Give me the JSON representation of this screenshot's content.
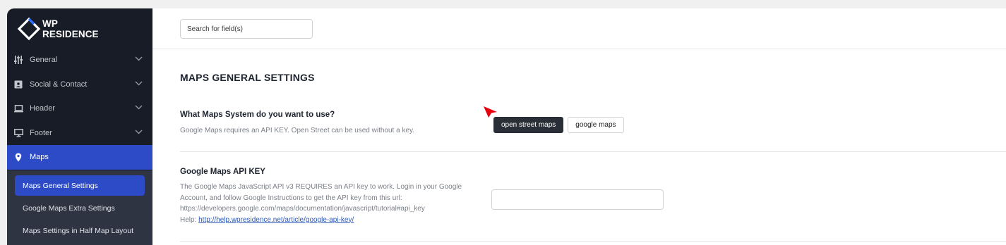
{
  "brand": {
    "line1": "WP",
    "line2": "RESIDENCE"
  },
  "sidebar": {
    "items": [
      {
        "label": "General",
        "icon": "sliders-icon"
      },
      {
        "label": "Social & Contact",
        "icon": "contact-card-icon"
      },
      {
        "label": "Header",
        "icon": "laptop-icon"
      },
      {
        "label": "Footer",
        "icon": "monitor-icon"
      },
      {
        "label": "Maps",
        "icon": "map-pin-icon",
        "active": true
      }
    ],
    "subitems": [
      {
        "label": "Maps General Settings",
        "active": true
      },
      {
        "label": "Google Maps Extra Settings"
      },
      {
        "label": "Maps Settings in Half Map Layout"
      }
    ]
  },
  "search": {
    "placeholder": "Search for field(s)"
  },
  "page": {
    "title": "MAPS GENERAL SETTINGS"
  },
  "maps_system": {
    "label": "What Maps System do you want to use?",
    "description": "Google Maps requires an API KEY. Open Street can be used without a key.",
    "options": [
      "open street maps",
      "google maps"
    ],
    "selected": "open street maps"
  },
  "api_key": {
    "label": "Google Maps API KEY",
    "desc_line1": "The Google Maps JavaScript API v3 REQUIRES an API key to work. Login in your Google",
    "desc_line2": "Account, and follow Google Instructions to get the API key from this url:",
    "desc_line3": "https://developers.google.com/maps/documentation/javascript/tutorial#api_key",
    "help_prefix": "Help: ",
    "help_link": "http://help.wpresidence.net/article/google-api-key/",
    "value": ""
  },
  "colors": {
    "sidebar_bg": "#171c26",
    "accent": "#2d4bc7",
    "subnav_bg": "#2e3442",
    "pointer": "#e8000d"
  }
}
